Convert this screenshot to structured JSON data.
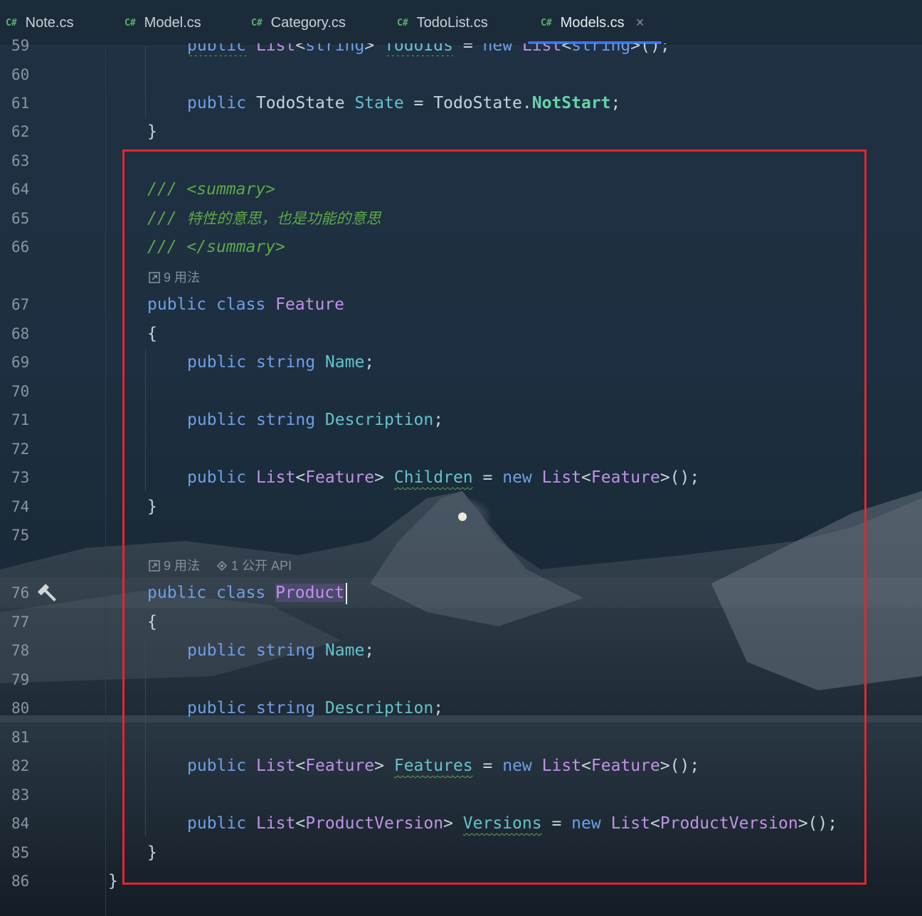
{
  "tabs": [
    {
      "lang": "C#",
      "label": "Note.cs"
    },
    {
      "lang": "C#",
      "label": "Model.cs"
    },
    {
      "lang": "C#",
      "label": "Category.cs"
    },
    {
      "lang": "C#",
      "label": "TodoList.cs"
    },
    {
      "lang": "C#",
      "label": "Models.cs",
      "close": "×"
    }
  ],
  "gutter": [
    "59",
    "60",
    "61",
    "62",
    "63",
    "64",
    "65",
    "66",
    "67",
    "68",
    "69",
    "70",
    "71",
    "72",
    "73",
    "74",
    "75",
    "76",
    "77",
    "78",
    "79",
    "80",
    "81",
    "82",
    "83",
    "84",
    "85",
    "86"
  ],
  "code": {
    "l59": {
      "a": "public",
      "b": "List",
      "c": "<",
      "d": "string",
      "e": ">",
      "f": "TodoIds",
      "g": "=",
      "h": "new",
      "i": "List",
      "j": "<",
      "k": "string",
      "l": ">();"
    },
    "l61": {
      "a": "public",
      "b": "TodoState",
      "c": "State",
      "d": "=",
      "e": "TodoState",
      "f": ".",
      "g": "NotStart",
      "h": ";"
    },
    "l62": "}",
    "l64": {
      "a": "///",
      "b": "<summary>"
    },
    "l65": {
      "a": "///",
      "b": "特性的意思，也是功能的意思"
    },
    "l66": {
      "a": "///",
      "b": "</summary>"
    },
    "hint1": "9 用法",
    "l67": {
      "a": "public",
      "b": "class",
      "c": "Feature"
    },
    "l68": "{",
    "l69": {
      "a": "public",
      "b": "string",
      "c": "Name",
      "d": ";"
    },
    "l71": {
      "a": "public",
      "b": "string",
      "c": "Description",
      "d": ";"
    },
    "l73": {
      "a": "public",
      "b": "List",
      "c": "<",
      "d": "Feature",
      "e": ">",
      "f": "Children",
      "g": "=",
      "h": "new",
      "i": "List",
      "j": "<",
      "k": "Feature",
      "l": ">();"
    },
    "l74": "}",
    "hint2a": "9 用法",
    "hint2b": "1 公开 API",
    "l76": {
      "a": "public",
      "b": "class",
      "c": "Product"
    },
    "l77": "{",
    "l78": {
      "a": "public",
      "b": "string",
      "c": "Name",
      "d": ";"
    },
    "l80": {
      "a": "public",
      "b": "string",
      "c": "Description",
      "d": ";"
    },
    "l82": {
      "a": "public",
      "b": "List",
      "c": "<",
      "d": "Feature",
      "e": ">",
      "f": "Features",
      "g": "=",
      "h": "new",
      "i": "List",
      "j": "<",
      "k": "Feature",
      "l": ">();"
    },
    "l84": {
      "a": "public",
      "b": "List",
      "c": "<",
      "d": "ProductVersion",
      "e": ">",
      "f": "Versions",
      "g": "=",
      "h": "new",
      "i": "List",
      "j": "<",
      "k": "ProductVersion",
      "l": ">();"
    },
    "l85": "}",
    "l86": "}"
  },
  "icons": {
    "gutter": "hammer-icon",
    "usages": "usages-icon",
    "api": "public-api-icon"
  },
  "colors": {
    "accent": "#3574f0",
    "highlight_box": "#e3262f",
    "keyword": "#6f9fe7",
    "type": "#c192e6",
    "comment": "#5fa84a"
  }
}
